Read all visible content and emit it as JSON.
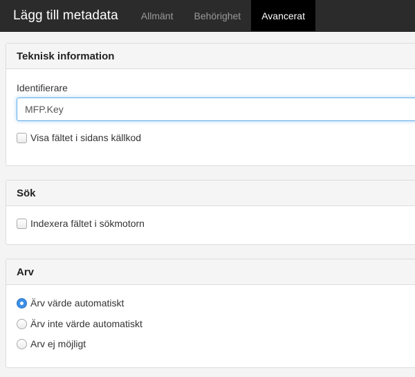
{
  "header": {
    "title": "Lägg till metadata",
    "tabs": [
      {
        "label": "Allmänt",
        "active": false
      },
      {
        "label": "Behörighet",
        "active": false
      },
      {
        "label": "Avancerat",
        "active": true
      }
    ]
  },
  "technical": {
    "heading": "Teknisk information",
    "identifier_label": "Identifierare",
    "identifier_value": "MFP.Key",
    "show_in_source_label": "Visa fältet i sidans källkod",
    "show_in_source_checked": false
  },
  "search": {
    "heading": "Sök",
    "index_label": "Indexera fältet i sökmotorn",
    "index_checked": false
  },
  "inheritance": {
    "heading": "Arv",
    "options": [
      {
        "label": "Ärv värde automatiskt",
        "selected": true
      },
      {
        "label": "Ärv inte värde automatiskt",
        "selected": false
      },
      {
        "label": "Arv ej möjligt",
        "selected": false
      }
    ]
  },
  "colors": {
    "topbar_bg": "#2b2b2b",
    "active_tab_bg": "#000000",
    "focus_border": "#66afe9",
    "radio_selected": "#3d8ee6"
  }
}
